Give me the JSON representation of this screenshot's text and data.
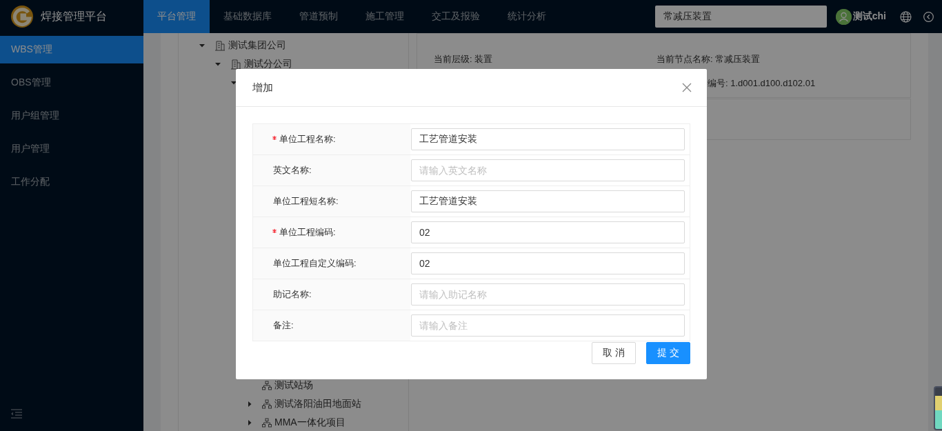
{
  "app": {
    "title": "焊接管理平台"
  },
  "nav": [
    {
      "label": "平台管理",
      "selected": true
    },
    {
      "label": "基础数据库",
      "selected": false
    },
    {
      "label": "管道预制",
      "selected": false
    },
    {
      "label": "施工管理",
      "selected": false
    },
    {
      "label": "交工及报验",
      "selected": false
    },
    {
      "label": "统计分析",
      "selected": false
    }
  ],
  "search": {
    "value": "常减压装置"
  },
  "user": {
    "name": "测试chi"
  },
  "sidebar": {
    "items": [
      {
        "label": "WBS管理",
        "selected": true
      },
      {
        "label": "OBS管理",
        "selected": false
      },
      {
        "label": "用户组管理",
        "selected": false
      },
      {
        "label": "用户管理",
        "selected": false
      },
      {
        "label": "工作分配",
        "selected": false
      }
    ]
  },
  "tree": [
    {
      "label": "测试集团公司",
      "kind": "building",
      "expanded": true,
      "children": [
        {
          "label": "测试分公司",
          "kind": "building",
          "expanded": true,
          "children": [
            {
              "expanded": true,
              "children": [
                {
                  "label": "测试站场",
                  "kind": "org"
                },
                {
                  "label": "测试洛阳油田地面站",
                  "kind": "org",
                  "expanded": false
                },
                {
                  "label": "MMA一体化项目",
                  "kind": "org",
                  "expanded": false
                }
              ]
            }
          ]
        }
      ]
    }
  ],
  "info": [
    {
      "text": "当前层级: 装置"
    },
    {
      "text": "当前节点名称: 常减压装置"
    },
    {
      "text": "编号: 1.d001.d100.d102.01"
    }
  ],
  "dialog": {
    "title": "增加",
    "fields": [
      {
        "label": "单位工程名称:",
        "required": true,
        "value": "工艺管道安装"
      },
      {
        "label": "英文名称:",
        "required": false,
        "placeholder": "请输入英文名称"
      },
      {
        "label": "单位工程短名称:",
        "required": false,
        "value": "工艺管道安装"
      },
      {
        "label": "单位工程编码:",
        "required": true,
        "value": "02"
      },
      {
        "label": "单位工程自定义编码:",
        "required": false,
        "value": "02"
      },
      {
        "label": "助记名称:",
        "required": false,
        "placeholder": "请输入助记名称"
      },
      {
        "label": "备注:",
        "required": false,
        "placeholder": "请输入备注"
      }
    ],
    "buttons": [
      {
        "label": "取 消",
        "kind": "default"
      },
      {
        "label": "提 交",
        "kind": "primary"
      }
    ]
  }
}
